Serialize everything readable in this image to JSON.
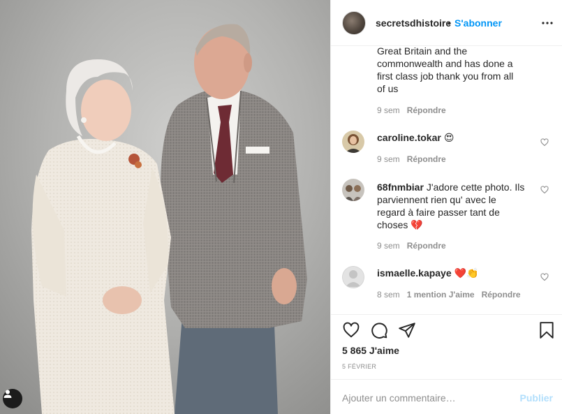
{
  "post": {
    "image_alt_content": "",
    "tag_icon": "person-tag-icon"
  },
  "header": {
    "username": "secretsdhistoire",
    "separator": "•",
    "follow_label": "S'abonner",
    "more_icon": "more-horizontal-icon"
  },
  "comments": [
    {
      "username": "",
      "text_lines": [
        "Great Britain and the",
        "commonwealth and has done a",
        "first class job thank you from all",
        "of us"
      ],
      "time": "9 sem",
      "reply_label": "Répondre"
    },
    {
      "username": "caroline.tokar",
      "text": "😍",
      "time": "9 sem",
      "reply_label": "Répondre"
    },
    {
      "username": "68fnmbiar",
      "text_lines": [
        "J'adore cette photo. Ils",
        "parviennent rien qu' avec le",
        "regard à faire passer tant de",
        "choses 💔"
      ],
      "time": "9 sem",
      "reply_label": "Répondre"
    },
    {
      "username": "ismaelle.kapaye",
      "text": "❤️👏",
      "time": "8 sem",
      "likes_label": "1 mention J'aime",
      "reply_label": "Répondre"
    }
  ],
  "actions": {
    "like_icon": "heart-icon",
    "comment_icon": "comment-icon",
    "share_icon": "paper-plane-icon",
    "save_icon": "bookmark-icon"
  },
  "likes_label": "5 865 J'aime",
  "date_label": "5 FÉVRIER",
  "add_comment": {
    "placeholder": "Ajouter un commentaire…",
    "publish_label": "Publier"
  },
  "colors": {
    "accent": "#0095f6",
    "publish_disabled": "#b2dffc",
    "muted_text": "#8e8e8e",
    "border": "#efefef"
  }
}
